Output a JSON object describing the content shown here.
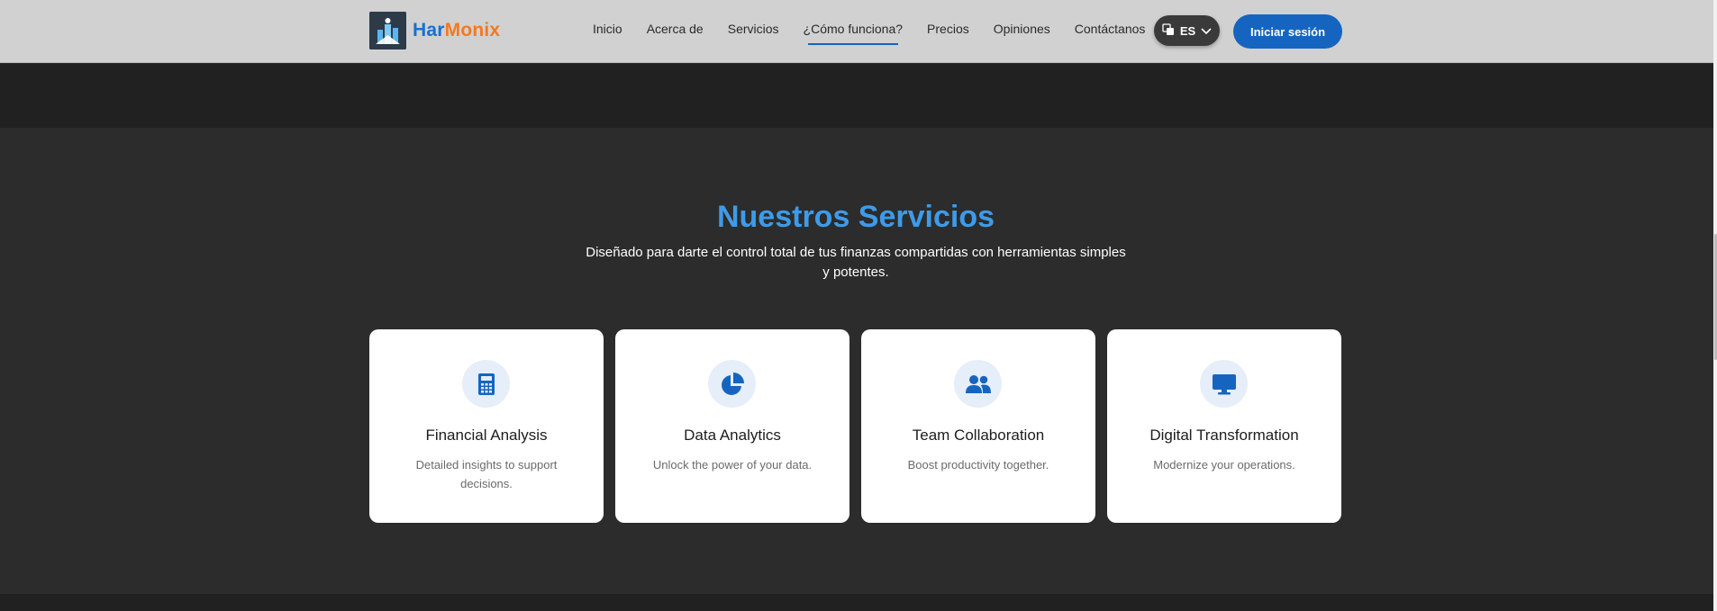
{
  "brand": {
    "name_part1": "Har",
    "name_part2": "Monix"
  },
  "nav": {
    "items": [
      {
        "label": "Inicio"
      },
      {
        "label": "Acerca de"
      },
      {
        "label": "Servicios"
      },
      {
        "label": "¿Cómo funciona?"
      },
      {
        "label": "Precios"
      },
      {
        "label": "Opiniones"
      },
      {
        "label": "Contáctanos"
      }
    ],
    "active": "¿Cómo funciona?"
  },
  "language": {
    "code": "ES"
  },
  "login_label": "Iniciar sesión",
  "services": {
    "title": "Nuestros Servicios",
    "subtitle": "Diseñado para darte el control total de tus finanzas compartidas con herramientas simples y potentes.",
    "cards": [
      {
        "icon": "calculator-icon",
        "title": "Financial Analysis",
        "desc": "Detailed insights to support decisions."
      },
      {
        "icon": "pie-chart-icon",
        "title": "Data Analytics",
        "desc": "Unlock the power of your data."
      },
      {
        "icon": "users-icon",
        "title": "Team Collaboration",
        "desc": "Boost productivity together."
      },
      {
        "icon": "monitor-icon",
        "title": "Digital Transformation",
        "desc": "Modernize your operations."
      }
    ]
  },
  "colors": {
    "accent": "#1565c0",
    "title": "#3d9be9",
    "brand_orange": "#f4791f"
  }
}
